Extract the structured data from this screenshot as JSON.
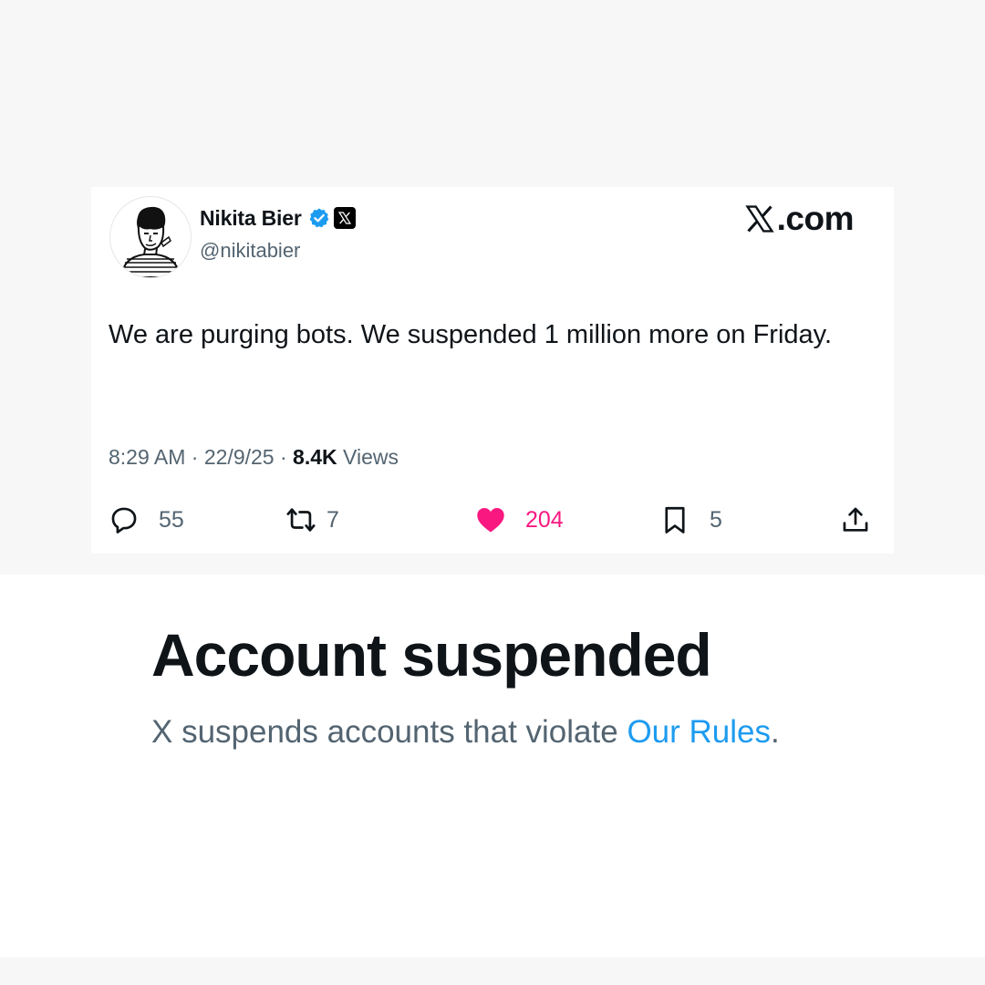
{
  "tweet": {
    "author": {
      "display_name": "Nikita Bier",
      "handle": "@nikitabier",
      "verified_icon": "verified-badge-icon",
      "affiliate_icon": "x-logo-icon"
    },
    "site_label": ".com",
    "text": "We are purging bots. We suspended 1 million more on Friday.",
    "time": "8:29 AM",
    "date": "22/9/25",
    "separator": "·",
    "views_count": "8.4K",
    "views_label": "Views",
    "actions": {
      "replies": "55",
      "reposts": "7",
      "likes": "204",
      "bookmarks": "5"
    }
  },
  "notice": {
    "title": "Account suspended",
    "description_prefix": "X suspends accounts that violate ",
    "rules_link": "Our Rules",
    "description_suffix": "."
  },
  "colors": {
    "text_primary": "#0f1419",
    "text_secondary": "#536471",
    "verified_blue": "#1d9bf0",
    "like_pink": "#f91880",
    "link_blue": "#1d9bf0"
  }
}
